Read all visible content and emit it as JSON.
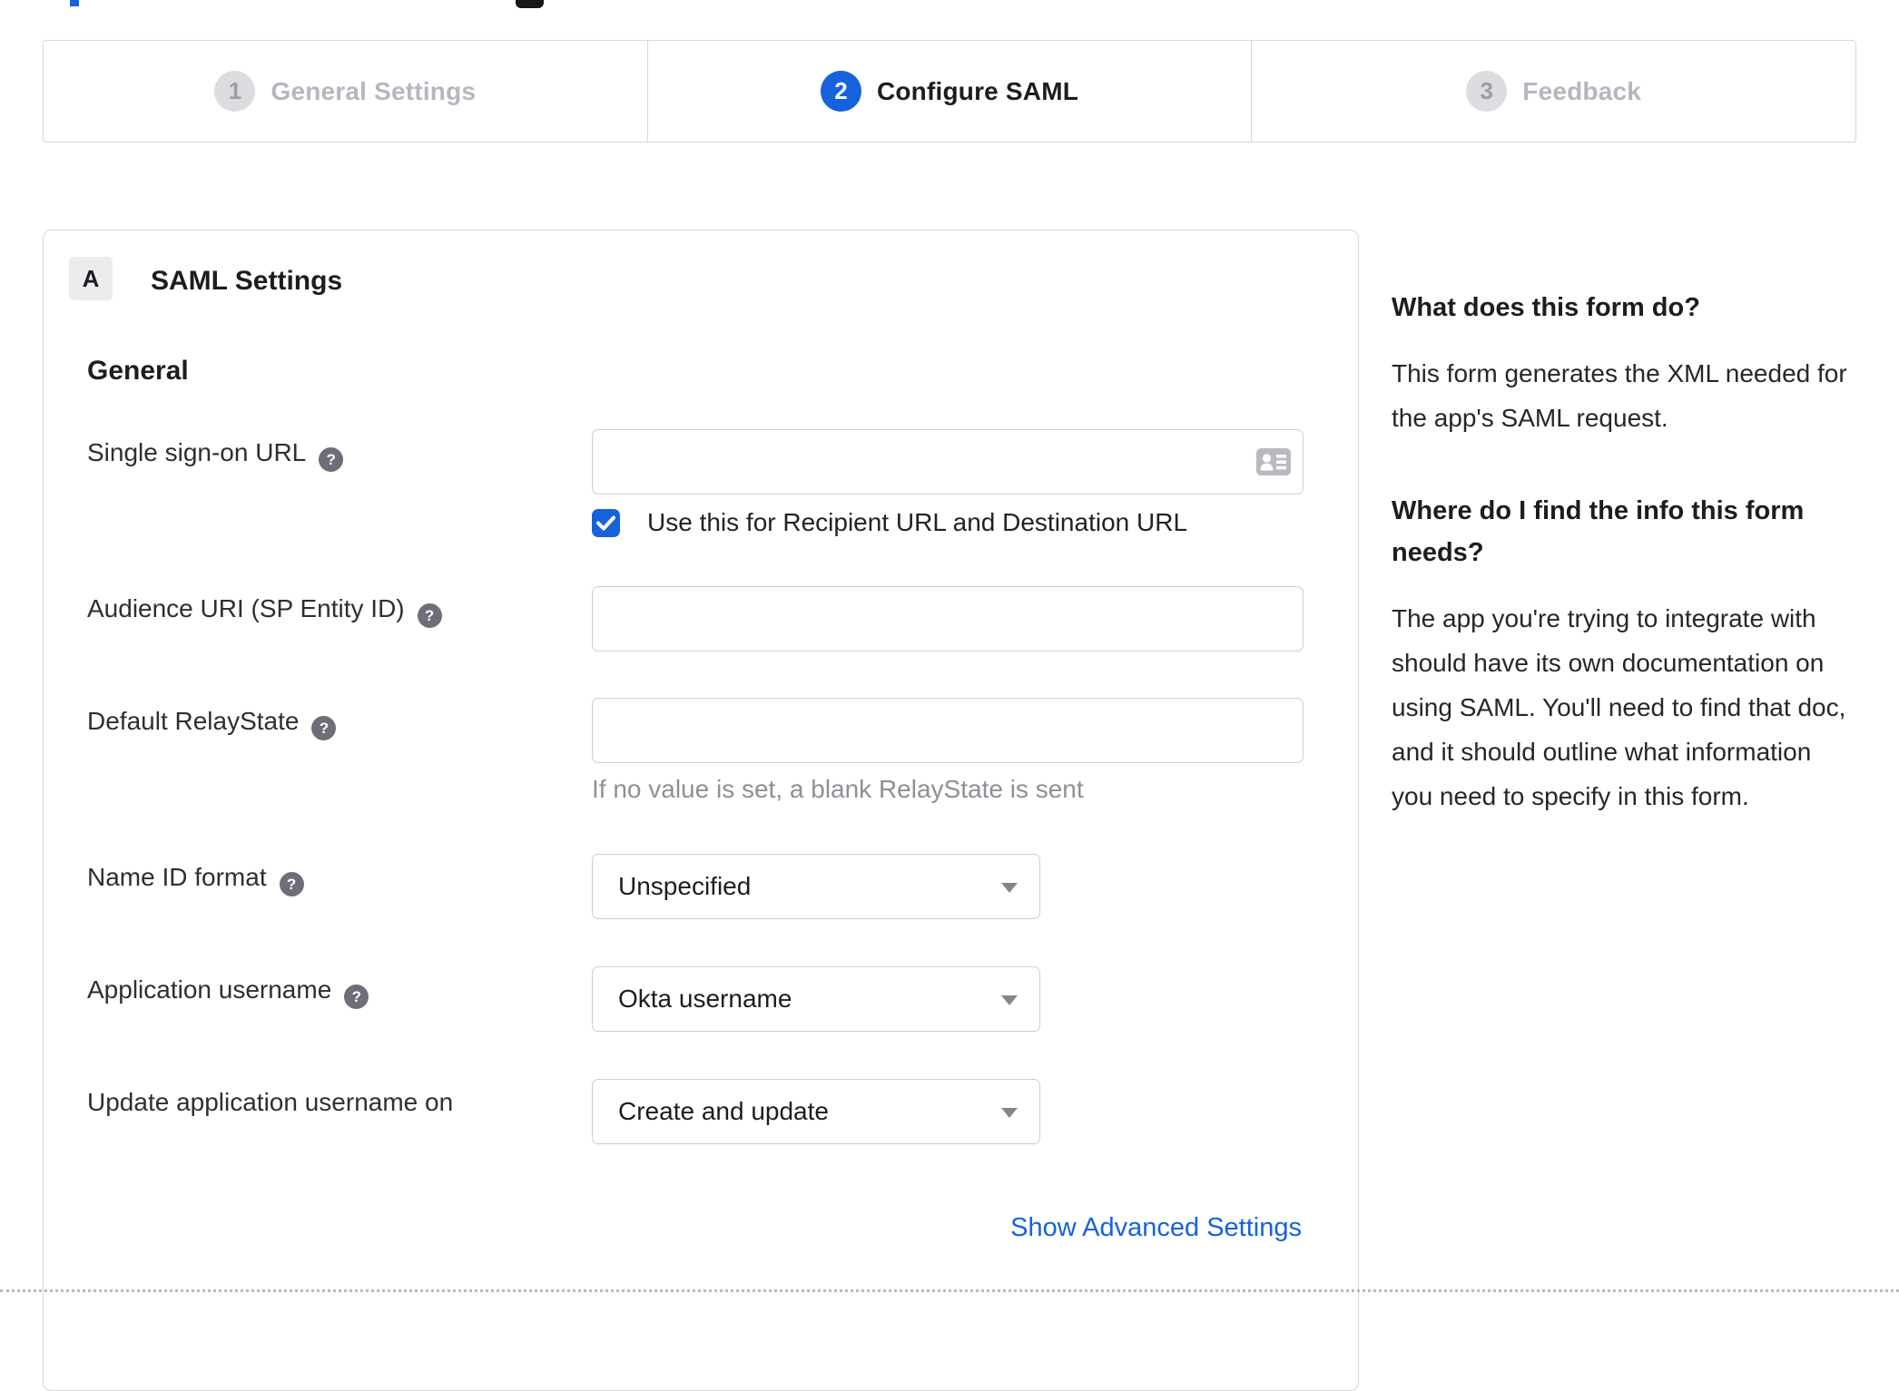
{
  "colors": {
    "accent": "#1662dd",
    "inactive_gray": "#b6b6bf",
    "border": "#d8d8dc",
    "help_icon_bg": "#6e6e78"
  },
  "stepper": {
    "steps": [
      {
        "number": "1",
        "label": "General Settings",
        "state": "inactive"
      },
      {
        "number": "2",
        "label": "Configure SAML",
        "state": "active"
      },
      {
        "number": "3",
        "label": "Feedback",
        "state": "inactive"
      }
    ]
  },
  "panel": {
    "badge": "A",
    "title": "SAML Settings",
    "section": "General",
    "help_glyph": "?",
    "fields": [
      {
        "label": "Single sign-on URL",
        "value": "",
        "checkbox_label": "Use this for Recipient URL and Destination URL",
        "checkbox_checked": true
      },
      {
        "label": "Audience URI (SP Entity ID)",
        "value": ""
      },
      {
        "label": "Default RelayState",
        "value": "",
        "hint": "If no value is set, a blank RelayState is sent"
      },
      {
        "label": "Name ID format",
        "value": "Unspecified"
      },
      {
        "label": "Application username",
        "value": "Okta username"
      },
      {
        "label": "Update application username on",
        "value": "Create and update"
      }
    ],
    "advanced_link": "Show Advanced Settings"
  },
  "sidebar": {
    "sections": [
      {
        "heading": "What does this form do?",
        "body": "This form generates the XML needed for the app's SAML request."
      },
      {
        "heading": "Where do I find the info this form needs?",
        "body": "The app you're trying to integrate with should have its own documentation on using SAML. You'll need to find that doc, and it should outline what information you need to specify in this form."
      }
    ]
  }
}
